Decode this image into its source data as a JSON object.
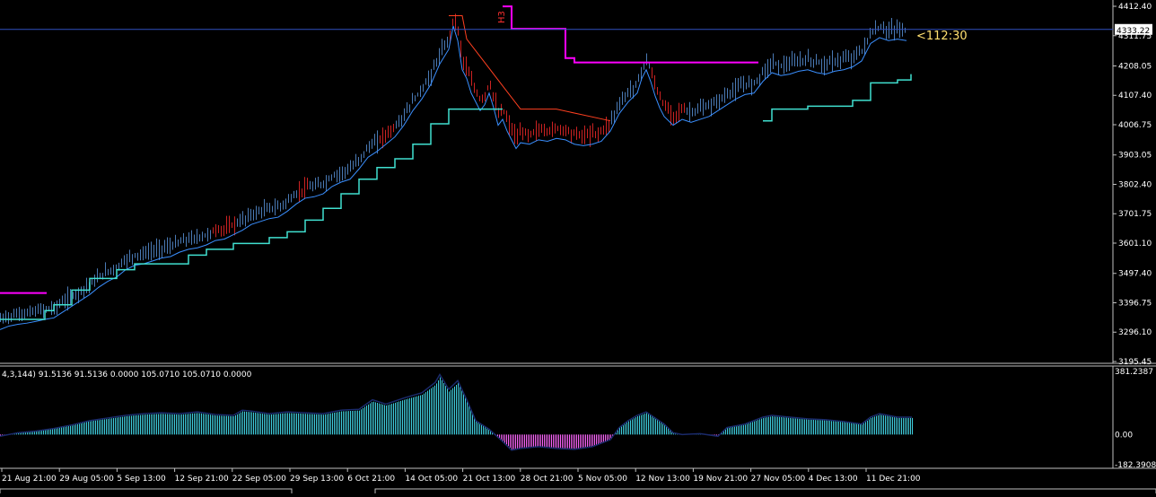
{
  "chart_data": {
    "type": "line",
    "main": {
      "y_ticks": [
        "4412.40",
        "4311.75",
        "4208.05",
        "4107.40",
        "4006.75",
        "3903.05",
        "3802.40",
        "3701.75",
        "3601.10",
        "3497.40",
        "3396.75",
        "3296.10",
        "3195.45"
      ],
      "ylim": [
        3195.45,
        4412.4
      ],
      "current_price": "4333.22",
      "timer": "<112:30",
      "markers": [
        "H3"
      ],
      "price_series": [
        [
          0,
          3340
        ],
        [
          10,
          3352
        ],
        [
          20,
          3358
        ],
        [
          30,
          3362
        ],
        [
          40,
          3368
        ],
        [
          50,
          3375
        ],
        [
          60,
          3380
        ],
        [
          70,
          3400
        ],
        [
          80,
          3420
        ],
        [
          90,
          3440
        ],
        [
          100,
          3460
        ],
        [
          110,
          3485
        ],
        [
          120,
          3505
        ],
        [
          130,
          3520
        ],
        [
          140,
          3545
        ],
        [
          150,
          3560
        ],
        [
          160,
          3565
        ],
        [
          170,
          3575
        ],
        [
          180,
          3585
        ],
        [
          190,
          3590
        ],
        [
          200,
          3605
        ],
        [
          210,
          3615
        ],
        [
          220,
          3620
        ],
        [
          230,
          3630
        ],
        [
          240,
          3645
        ],
        [
          250,
          3650
        ],
        [
          260,
          3665
        ],
        [
          270,
          3680
        ],
        [
          280,
          3700
        ],
        [
          290,
          3710
        ],
        [
          300,
          3720
        ],
        [
          310,
          3725
        ],
        [
          320,
          3745
        ],
        [
          330,
          3770
        ],
        [
          340,
          3790
        ],
        [
          350,
          3795
        ],
        [
          360,
          3805
        ],
        [
          370,
          3830
        ],
        [
          380,
          3845
        ],
        [
          390,
          3855
        ],
        [
          400,
          3890
        ],
        [
          410,
          3930
        ],
        [
          420,
          3950
        ],
        [
          430,
          3975
        ],
        [
          440,
          4000
        ],
        [
          450,
          4040
        ],
        [
          460,
          4090
        ],
        [
          470,
          4130
        ],
        [
          480,
          4180
        ],
        [
          490,
          4250
        ],
        [
          500,
          4300
        ],
        [
          505,
          4380
        ],
        [
          510,
          4330
        ],
        [
          515,
          4230
        ],
        [
          520,
          4200
        ],
        [
          525,
          4150
        ],
        [
          530,
          4120
        ],
        [
          535,
          4090
        ],
        [
          540,
          4110
        ],
        [
          545,
          4150
        ],
        [
          550,
          4100
        ],
        [
          555,
          4040
        ],
        [
          560,
          4060
        ],
        [
          565,
          4020
        ],
        [
          570,
          3990
        ],
        [
          575,
          3960
        ],
        [
          580,
          3980
        ],
        [
          590,
          3975
        ],
        [
          600,
          3990
        ],
        [
          610,
          3985
        ],
        [
          620,
          3995
        ],
        [
          630,
          3990
        ],
        [
          640,
          3975
        ],
        [
          650,
          3970
        ],
        [
          660,
          3975
        ],
        [
          670,
          3985
        ],
        [
          680,
          4020
        ],
        [
          690,
          4080
        ],
        [
          700,
          4120
        ],
        [
          710,
          4150
        ],
        [
          715,
          4200
        ],
        [
          720,
          4230
        ],
        [
          725,
          4190
        ],
        [
          730,
          4140
        ],
        [
          735,
          4100
        ],
        [
          740,
          4070
        ],
        [
          750,
          4040
        ],
        [
          760,
          4060
        ],
        [
          770,
          4050
        ],
        [
          780,
          4060
        ],
        [
          790,
          4070
        ],
        [
          800,
          4090
        ],
        [
          810,
          4110
        ],
        [
          820,
          4130
        ],
        [
          830,
          4145
        ],
        [
          840,
          4150
        ],
        [
          850,
          4190
        ],
        [
          860,
          4220
        ],
        [
          870,
          4210
        ],
        [
          880,
          4215
        ],
        [
          890,
          4225
        ],
        [
          900,
          4230
        ],
        [
          910,
          4220
        ],
        [
          920,
          4215
        ],
        [
          930,
          4225
        ],
        [
          940,
          4230
        ],
        [
          950,
          4240
        ],
        [
          960,
          4260
        ],
        [
          970,
          4320
        ],
        [
          980,
          4340
        ],
        [
          990,
          4330
        ],
        [
          1000,
          4335
        ],
        [
          1010,
          4330
        ]
      ],
      "support_series": [
        [
          0,
          3340
        ],
        [
          50,
          3370
        ],
        [
          60,
          3390
        ],
        [
          80,
          3440
        ],
        [
          100,
          3480
        ],
        [
          130,
          3510
        ],
        [
          150,
          3530
        ],
        [
          210,
          3560
        ],
        [
          230,
          3580
        ],
        [
          260,
          3600
        ],
        [
          300,
          3620
        ],
        [
          320,
          3640
        ],
        [
          340,
          3680
        ],
        [
          360,
          3720
        ],
        [
          380,
          3770
        ],
        [
          400,
          3820
        ],
        [
          420,
          3860
        ],
        [
          440,
          3890
        ],
        [
          460,
          3940
        ],
        [
          480,
          4010
        ],
        [
          500,
          4060
        ],
        [
          520,
          4060
        ],
        [
          560,
          4060
        ]
      ],
      "support_series_2": [
        [
          850,
          4020
        ],
        [
          860,
          4060
        ],
        [
          880,
          4060
        ],
        [
          900,
          4070
        ],
        [
          950,
          4090
        ],
        [
          970,
          4150
        ],
        [
          1000,
          4160
        ],
        [
          1015,
          4180
        ]
      ],
      "resist_series": [
        [
          0,
          3430
        ],
        [
          52,
          3430
        ]
      ],
      "resist_series_2": [
        [
          560,
          4412
        ],
        [
          568,
          4412
        ],
        [
          570,
          4335
        ],
        [
          625,
          4335
        ],
        [
          630,
          4235
        ],
        [
          640,
          4220
        ],
        [
          845,
          4220
        ]
      ]
    },
    "indicator": {
      "label": "4,3,144) 91.5136 91.5136 0.0000 105.0710 105.0710 0.0000",
      "y_ticks": [
        "381.2387",
        "0.00",
        "-182.3908"
      ],
      "ylim": [
        -182.3908,
        381.2387
      ],
      "histogram": [
        [
          0,
          -10
        ],
        [
          20,
          10
        ],
        [
          40,
          20
        ],
        [
          60,
          35
        ],
        [
          80,
          55
        ],
        [
          100,
          80
        ],
        [
          120,
          95
        ],
        [
          140,
          110
        ],
        [
          160,
          120
        ],
        [
          180,
          125
        ],
        [
          200,
          120
        ],
        [
          220,
          130
        ],
        [
          240,
          115
        ],
        [
          260,
          110
        ],
        [
          270,
          140
        ],
        [
          280,
          135
        ],
        [
          300,
          120
        ],
        [
          320,
          130
        ],
        [
          340,
          125
        ],
        [
          360,
          120
        ],
        [
          380,
          140
        ],
        [
          400,
          145
        ],
        [
          415,
          200
        ],
        [
          430,
          175
        ],
        [
          450,
          210
        ],
        [
          470,
          240
        ],
        [
          485,
          300
        ],
        [
          490,
          345
        ],
        [
          500,
          260
        ],
        [
          510,
          310
        ],
        [
          520,
          200
        ],
        [
          530,
          80
        ],
        [
          545,
          30
        ],
        [
          560,
          -40
        ],
        [
          570,
          -90
        ],
        [
          580,
          -80
        ],
        [
          600,
          -70
        ],
        [
          620,
          -80
        ],
        [
          640,
          -85
        ],
        [
          660,
          -70
        ],
        [
          680,
          -30
        ],
        [
          690,
          40
        ],
        [
          700,
          80
        ],
        [
          710,
          110
        ],
        [
          720,
          130
        ],
        [
          730,
          95
        ],
        [
          740,
          60
        ],
        [
          750,
          10
        ],
        [
          760,
          0
        ],
        [
          780,
          5
        ],
        [
          800,
          -10
        ],
        [
          810,
          40
        ],
        [
          830,
          60
        ],
        [
          850,
          100
        ],
        [
          860,
          110
        ],
        [
          880,
          100
        ],
        [
          900,
          90
        ],
        [
          920,
          85
        ],
        [
          940,
          75
        ],
        [
          960,
          60
        ],
        [
          970,
          100
        ],
        [
          980,
          120
        ],
        [
          1000,
          100
        ],
        [
          1016,
          100
        ]
      ]
    },
    "x_labels": [
      "21 Aug 21:00",
      "29 Aug 05:00",
      "5 Sep 13:00",
      "12 Sep 21:00",
      "22 Sep 05:00",
      "29 Sep 13:00",
      "6 Oct 21:00",
      "14 Oct 05:00",
      "21 Oct 13:00",
      "28 Oct 21:00",
      "5 Nov 05:00",
      "12 Nov 13:00",
      "19 Nov 21:00",
      "27 Nov 05:00",
      "4 Dec 13:00",
      "11 Dec 21:00"
    ],
    "colors": {
      "background": "#000000",
      "bull_bar": "#4a7ab5",
      "bear_bar": "#cc2222",
      "support_line": "#40e0d0",
      "resist_line": "#ff00ff",
      "ma_line": "#3a8fff",
      "trail_line": "#ff4020",
      "histogram_pos": "#40d0e0",
      "histogram_neg": "#ff66ff",
      "price_line": "#3050c0",
      "axis_text": "#ffffff",
      "timer_text": "#ffe070"
    }
  }
}
